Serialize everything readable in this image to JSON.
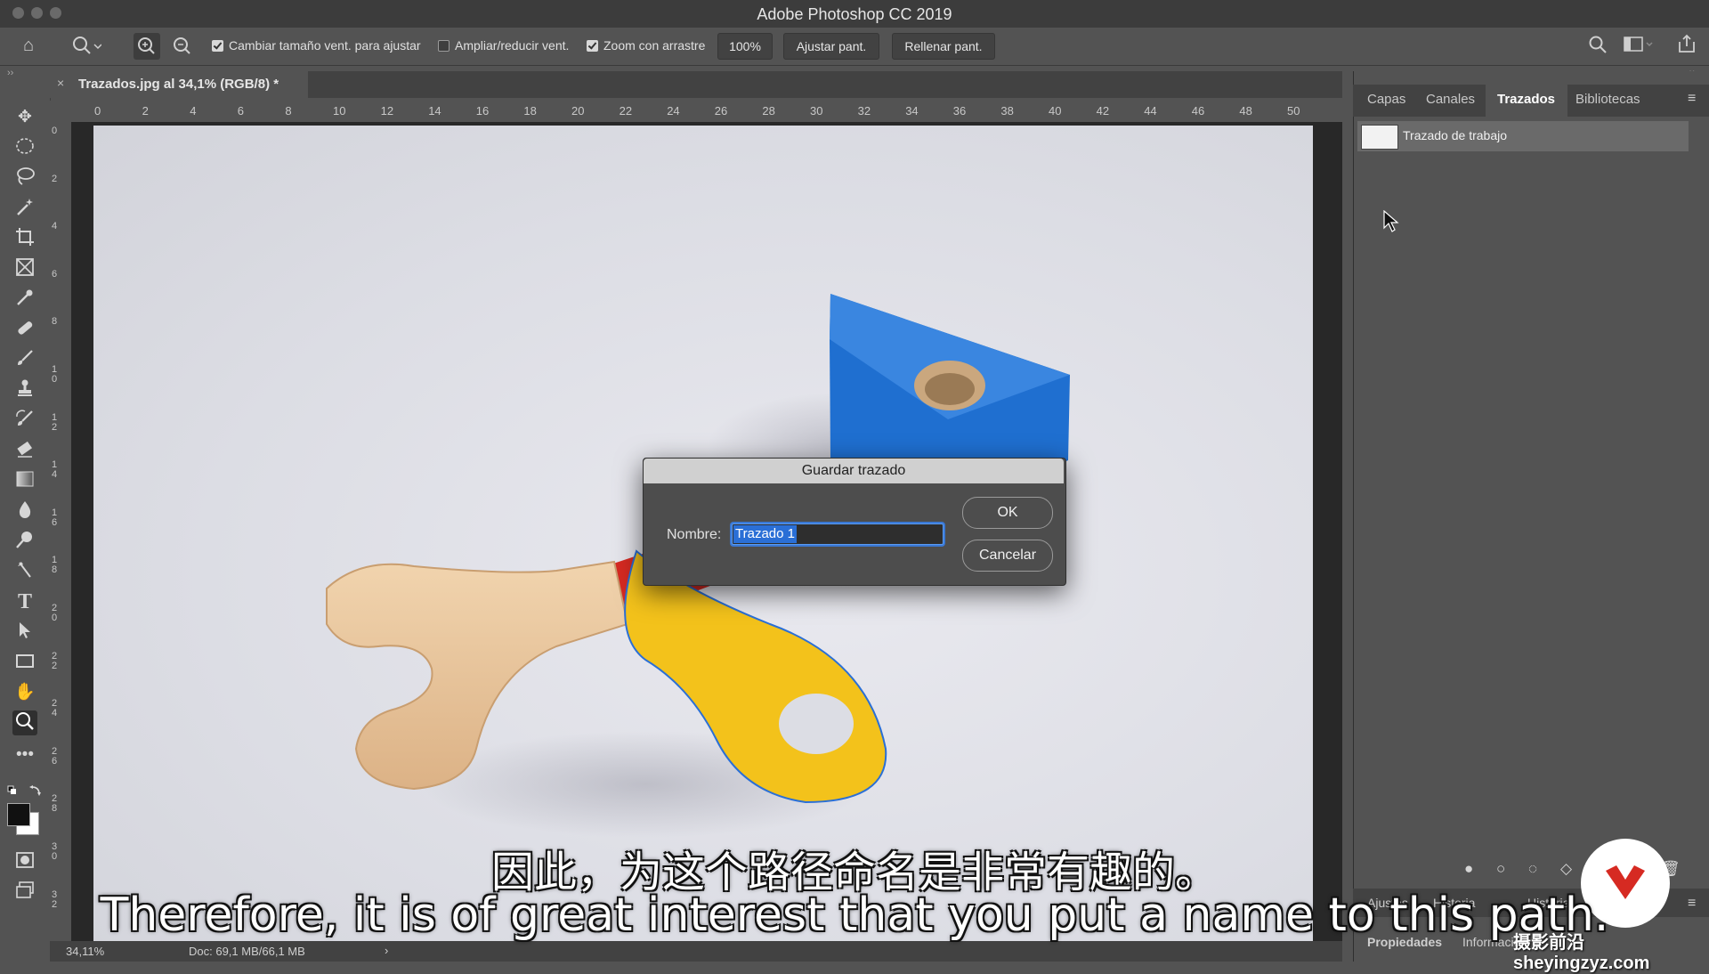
{
  "app": {
    "title": "Adobe Photoshop CC 2019"
  },
  "options_bar": {
    "resize_windows": {
      "label": "Cambiar tamaño vent. para ajustar",
      "checked": true
    },
    "zoom_all": {
      "label": "Ampliar/reducir vent.",
      "checked": false
    },
    "scrubby_zoom": {
      "label": "Zoom con arrastre",
      "checked": true
    },
    "zoom_100": "100%",
    "fit_screen": "Ajustar pant.",
    "fill_screen": "Rellenar pant."
  },
  "document": {
    "tab_label": "Trazados.jpg al 34,1% (RGB/8) *",
    "close_glyph": "×"
  },
  "rulers": {
    "horizontal": [
      "0",
      "2",
      "4",
      "6",
      "8",
      "10",
      "12",
      "14",
      "16",
      "18",
      "20",
      "22",
      "24",
      "26",
      "28",
      "30",
      "32",
      "34",
      "36",
      "38",
      "40",
      "42",
      "44",
      "46",
      "48",
      "50"
    ],
    "vertical": [
      "0",
      "2",
      "4",
      "6",
      "8",
      "1\n0",
      "1\n2",
      "1\n4",
      "1\n6",
      "1\n8",
      "2\n0",
      "2\n2",
      "2\n4",
      "2\n6",
      "2\n8",
      "3\n0",
      "3\n2"
    ]
  },
  "status_bar": {
    "zoom": "34,11%",
    "doc": "Doc: 69,1 MB/66,1 MB",
    "arrow": "›"
  },
  "panel": {
    "tabs": [
      "Capas",
      "Canales",
      "Trazados",
      "Bibliotecas"
    ],
    "active_tab": "Trazados",
    "path_item": "Trazado de trabajo",
    "bottom_tabs_row1": [
      "Ajustes",
      "Historia",
      "Historia"
    ],
    "bottom_tabs_row2": [
      "Propiedades",
      "Información"
    ]
  },
  "dialog": {
    "title": "Guardar trazado",
    "name_label": "Nombre:",
    "name_value": "Trazado 1",
    "ok": "OK",
    "cancel": "Cancelar"
  },
  "subtitles": {
    "zh": "因此，为这个路径命名是非常有趣的。",
    "en": "Therefore, it is of great interest that you put a name to this path."
  },
  "watermark": "摄影前沿 sheyingzyz.com",
  "colors": {
    "accent": "#2a6fd6",
    "cube": "#1f6fd0",
    "yellow": "#f3c21b",
    "red": "#d62a22",
    "wood": "#e8c59c"
  }
}
